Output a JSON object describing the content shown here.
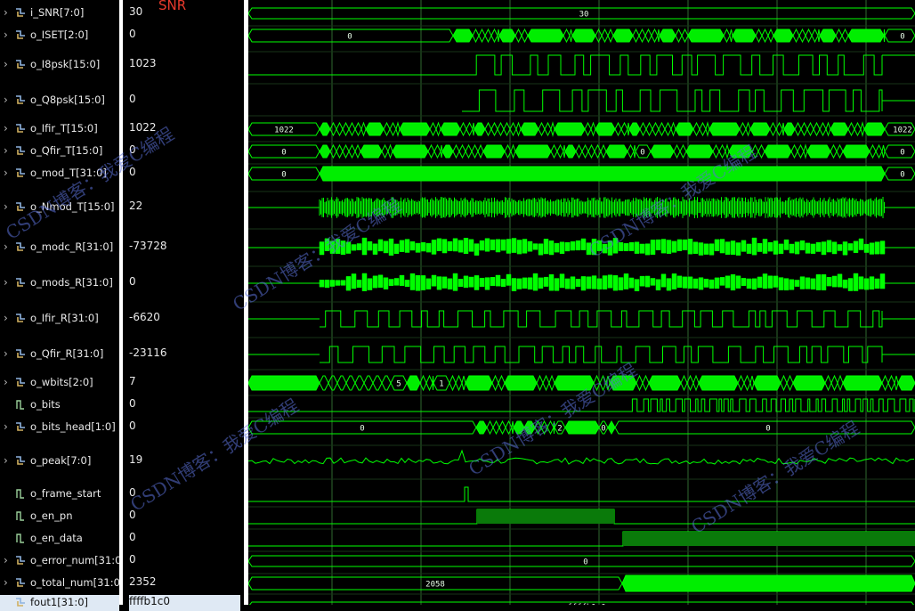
{
  "snr_label": "SNR",
  "signals": [
    {
      "name": "i_SNR[7:0]",
      "value": "30",
      "kind": "bus",
      "expand": true
    },
    {
      "name": "o_ISET[2:0]",
      "value": "0",
      "kind": "bus",
      "expand": true
    },
    {
      "name": "o_I8psk[15:0]",
      "value": "1023",
      "kind": "bus",
      "expand": true
    },
    {
      "name": "o_Q8psk[15:0]",
      "value": "0",
      "kind": "bus",
      "expand": true
    },
    {
      "name": "o_Ifir_T[15:0]",
      "value": "1022",
      "kind": "bus",
      "expand": true
    },
    {
      "name": "o_Qfir_T[15:0]",
      "value": "0",
      "kind": "bus",
      "expand": true
    },
    {
      "name": "o_mod_T[31:0]",
      "value": "0",
      "kind": "bus",
      "expand": true
    },
    {
      "name": "o_Nmod_T[15:0]",
      "value": "22",
      "kind": "bus",
      "expand": true
    },
    {
      "name": "o_modc_R[31:0]",
      "value": "-73728",
      "kind": "bus",
      "expand": true
    },
    {
      "name": "o_mods_R[31:0]",
      "value": "0",
      "kind": "bus",
      "expand": true
    },
    {
      "name": "o_Ifir_R[31:0]",
      "value": "-6620",
      "kind": "bus",
      "expand": true
    },
    {
      "name": "o_Qfir_R[31:0]",
      "value": "-23116",
      "kind": "bus",
      "expand": true
    },
    {
      "name": "o_wbits[2:0]",
      "value": "7",
      "kind": "bus",
      "expand": true
    },
    {
      "name": "o_bits",
      "value": "0",
      "kind": "bit",
      "expand": false
    },
    {
      "name": "o_bits_head[1:0]",
      "value": "0",
      "kind": "bus",
      "expand": true
    },
    {
      "name": "o_peak[7:0]",
      "value": "19",
      "kind": "bus",
      "expand": true
    },
    {
      "name": "o_frame_start",
      "value": "0",
      "kind": "bit",
      "expand": false
    },
    {
      "name": "o_en_pn",
      "value": "0",
      "kind": "bit",
      "expand": false
    },
    {
      "name": "o_en_data",
      "value": "0",
      "kind": "bit",
      "expand": false
    },
    {
      "name": "o_error_num[31:0]",
      "value": "0",
      "kind": "bus",
      "expand": true
    },
    {
      "name": "o_total_num[31:0]",
      "value": "2352",
      "kind": "bus",
      "expand": true
    },
    {
      "name": "fout1[31:0]",
      "value": "ffffb1c0",
      "kind": "bus",
      "expand": false,
      "selected": true
    }
  ],
  "wave_labels": {
    "snr": "30",
    "iset": "0",
    "iset_end": "0",
    "ifir_start": "1022",
    "ifir_end": "1022",
    "qfir_start": "0",
    "qfir_mid": "0",
    "qfir_end": "0",
    "mod_start": "0",
    "mod_end": "0",
    "wbits_a": "5",
    "wbits_b": "1",
    "bits_head_a": "0",
    "bits_head_b": "2",
    "bits_head_c": "0",
    "bits_head_d": "0",
    "error_num": "0",
    "total_num": "2058",
    "fout1": "ffffb1c0"
  },
  "watermark": {
    "text1": "CSDN博客：我爱C编程",
    "text2": "CSDN博客：我爱C编程"
  },
  "colors": {
    "wave": "#00ff00",
    "grid": "#2f6a2f",
    "bus_fill": "#00ee00",
    "dim_fill": "#0a7a0a",
    "snr": "#e83a2c",
    "watermark": "#5a6fd6"
  }
}
